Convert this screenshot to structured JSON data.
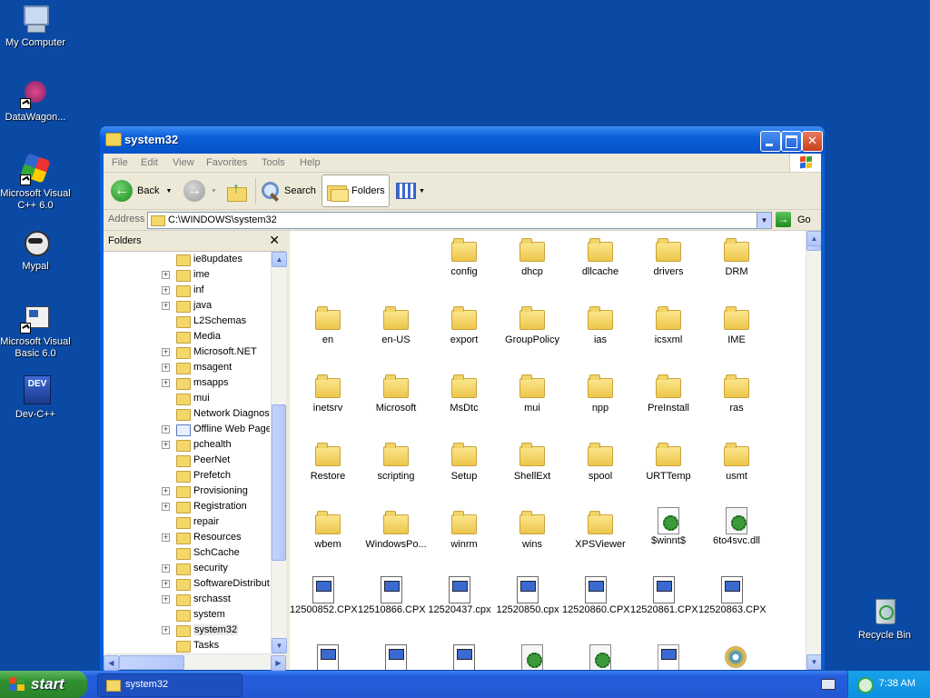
{
  "desktop": {
    "icons": [
      {
        "label": "My Computer",
        "icon": "computer-icon"
      },
      {
        "label": "DataWagon...",
        "icon": "datawagon-icon"
      },
      {
        "label": "Microsoft Visual C++ 6.0",
        "icon": "visual-cpp-icon"
      },
      {
        "label": "Mypal",
        "icon": "mypal-icon"
      },
      {
        "label": "Microsoft Visual Basic 6.0",
        "icon": "visual-basic-icon"
      },
      {
        "label": "Dev-C++",
        "icon": "dev-cpp-icon"
      },
      {
        "label": "Recycle Bin",
        "icon": "recycle-bin-icon"
      }
    ],
    "dev_icon_text": "DEV"
  },
  "window": {
    "title": "system32",
    "menu": [
      "File",
      "Edit",
      "View",
      "Favorites",
      "Tools",
      "Help"
    ],
    "toolbar": {
      "back": "Back",
      "search": "Search",
      "folders": "Folders"
    },
    "address": {
      "label": "Address",
      "value": "C:\\WINDOWS\\system32",
      "go": "Go"
    },
    "folders_pane": {
      "title": "Folders",
      "items": [
        {
          "name": "ie8updates",
          "expandable": false
        },
        {
          "name": "ime",
          "expandable": true
        },
        {
          "name": "inf",
          "expandable": true
        },
        {
          "name": "java",
          "expandable": true
        },
        {
          "name": "L2Schemas",
          "expandable": false
        },
        {
          "name": "Media",
          "expandable": false
        },
        {
          "name": "Microsoft.NET",
          "expandable": true
        },
        {
          "name": "msagent",
          "expandable": true
        },
        {
          "name": "msapps",
          "expandable": true
        },
        {
          "name": "mui",
          "expandable": false
        },
        {
          "name": "Network Diagnost",
          "expandable": false
        },
        {
          "name": "Offline Web Page",
          "expandable": true
        },
        {
          "name": "pchealth",
          "expandable": true
        },
        {
          "name": "PeerNet",
          "expandable": false
        },
        {
          "name": "Prefetch",
          "expandable": false
        },
        {
          "name": "Provisioning",
          "expandable": true
        },
        {
          "name": "Registration",
          "expandable": true
        },
        {
          "name": "repair",
          "expandable": false
        },
        {
          "name": "Resources",
          "expandable": true
        },
        {
          "name": "SchCache",
          "expandable": false
        },
        {
          "name": "security",
          "expandable": true
        },
        {
          "name": "SoftwareDistribut",
          "expandable": true
        },
        {
          "name": "srchasst",
          "expandable": true
        },
        {
          "name": "system",
          "expandable": false
        },
        {
          "name": "system32",
          "expandable": true
        },
        {
          "name": "Tasks",
          "expandable": false
        }
      ]
    },
    "files": [
      {
        "name": "config",
        "type": "folder"
      },
      {
        "name": "dhcp",
        "type": "folder"
      },
      {
        "name": "dllcache",
        "type": "folder"
      },
      {
        "name": "drivers",
        "type": "folder"
      },
      {
        "name": "DRM",
        "type": "folder"
      },
      {
        "name": "en",
        "type": "folder"
      },
      {
        "name": "en-US",
        "type": "folder"
      },
      {
        "name": "export",
        "type": "folder"
      },
      {
        "name": "GroupPolicy",
        "type": "folder"
      },
      {
        "name": "ias",
        "type": "folder"
      },
      {
        "name": "icsxml",
        "type": "folder"
      },
      {
        "name": "IME",
        "type": "folder"
      },
      {
        "name": "inetsrv",
        "type": "folder"
      },
      {
        "name": "Microsoft",
        "type": "folder"
      },
      {
        "name": "MsDtc",
        "type": "folder"
      },
      {
        "name": "mui",
        "type": "folder"
      },
      {
        "name": "npp",
        "type": "folder"
      },
      {
        "name": "PreInstall",
        "type": "folder"
      },
      {
        "name": "ras",
        "type": "folder"
      },
      {
        "name": "Restore",
        "type": "folder"
      },
      {
        "name": "scripting",
        "type": "folder"
      },
      {
        "name": "Setup",
        "type": "folder"
      },
      {
        "name": "ShellExt",
        "type": "folder"
      },
      {
        "name": "spool",
        "type": "folder"
      },
      {
        "name": "URTTemp",
        "type": "folder"
      },
      {
        "name": "usmt",
        "type": "folder"
      },
      {
        "name": "wbem",
        "type": "folder"
      },
      {
        "name": "WindowsPo...",
        "type": "folder"
      },
      {
        "name": "winrm",
        "type": "folder"
      },
      {
        "name": "wins",
        "type": "folder"
      },
      {
        "name": "XPSViewer",
        "type": "folder"
      },
      {
        "name": "$winnt$",
        "type": "ini"
      },
      {
        "name": "6to4svc.dll",
        "type": "dll"
      },
      {
        "name": "12500852.CPX",
        "type": "cpx"
      },
      {
        "name": "12510866.CPX",
        "type": "cpx"
      },
      {
        "name": "12520437.cpx",
        "type": "cpx"
      },
      {
        "name": "12520850.cpx",
        "type": "cpx"
      },
      {
        "name": "12520860.CPX",
        "type": "cpx"
      },
      {
        "name": "12520861.CPX",
        "type": "cpx"
      },
      {
        "name": "12520863.CPX",
        "type": "cpx"
      }
    ]
  },
  "taskbar": {
    "start": "start",
    "task": "system32",
    "clock": "7:38 AM"
  }
}
